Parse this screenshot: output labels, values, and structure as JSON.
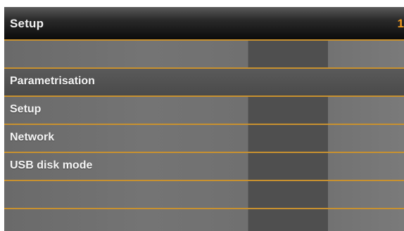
{
  "header": {
    "title": "Setup",
    "page_number": "1"
  },
  "menu": {
    "items": [
      {
        "label": ""
      },
      {
        "label": "Parametrisation"
      },
      {
        "label": "Setup"
      },
      {
        "label": "Network"
      },
      {
        "label": "USB disk mode"
      },
      {
        "label": ""
      },
      {
        "label": ""
      }
    ],
    "selected_index": 1
  },
  "colors": {
    "accent": "#c8912f",
    "page_number": "#f29a1e",
    "title_bar": "#0b0b0b"
  }
}
